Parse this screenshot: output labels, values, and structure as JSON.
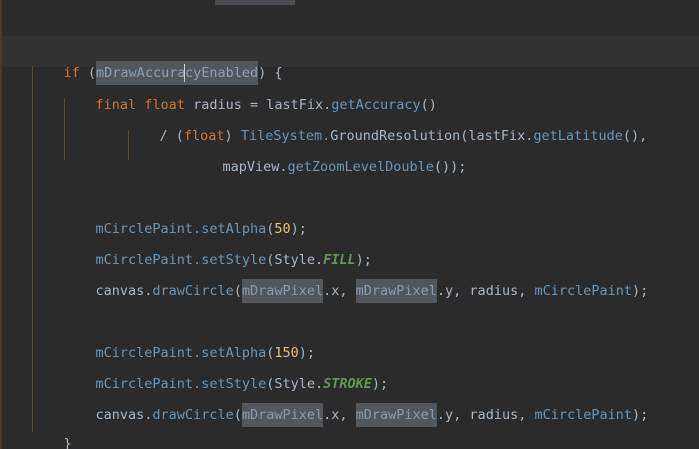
{
  "colors": {
    "background": "#2b2b2b",
    "keyword": "#cc7832",
    "method": "#6897bb",
    "number": "#e6c07b",
    "constant": "#629755",
    "text": "#a9b7c6",
    "highlight": "#52575c"
  },
  "code": {
    "l1": {
      "kw_if": "if",
      "open": " (",
      "hl_a": "mDrawAccura",
      "hl_b": "cyEnabled",
      "close": ") {"
    },
    "l2": {
      "kw_final": "final",
      "kw_float": "float",
      "var": " radius = lastFix.",
      "call": "getAccuracy",
      "paren": "()"
    },
    "l3": {
      "slash": "/ (",
      "kw_float": "float",
      "close": ") ",
      "cls": "TileSystem.",
      "call": "GroundResolution",
      "arg": "(lastFix.",
      "call2": "getLatitude",
      "tail": "(),"
    },
    "l4": {
      "obj": "mapView.",
      "call": "getZoomLevelDouble",
      "tail": "());"
    },
    "l5": {
      "obj": "mCirclePaint.",
      "call": "setAlpha",
      "open": "(",
      "num": "50",
      "close": ");"
    },
    "l6": {
      "obj": "mCirclePaint.",
      "call": "setStyle",
      "open": "(Style.",
      "const": "FILL",
      "close": ");"
    },
    "l7": {
      "obj": "canvas.",
      "call": "drawCircle",
      "open": "(",
      "hl1": "mDrawPixel",
      "x": ".x, ",
      "hl2": "mDrawPixel",
      "y": ".y, radius, ",
      "field": "mCirclePaint",
      "close": ");"
    },
    "l8": {
      "obj": "mCirclePaint.",
      "call": "setAlpha",
      "open": "(",
      "num": "150",
      "close": ");"
    },
    "l9": {
      "obj": "mCirclePaint.",
      "call": "setStyle",
      "open": "(Style.",
      "const": "STROKE",
      "close": ");"
    },
    "l10": {
      "obj": "canvas.",
      "call": "drawCircle",
      "open": "(",
      "hl1": "mDrawPixel",
      "x": ".x, ",
      "hl2": "mDrawPixel",
      "y": ".y, radius, ",
      "field": "mCirclePaint",
      "close": ");"
    },
    "l11": {
      "brace": "}"
    }
  }
}
